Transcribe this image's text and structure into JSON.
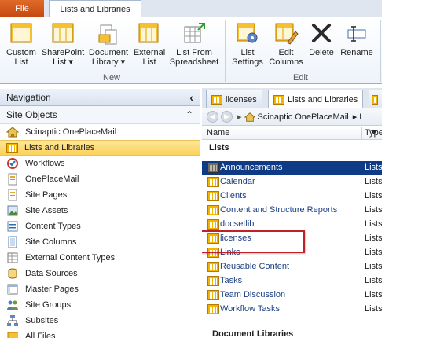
{
  "ribbon_tabs": {
    "file": "File",
    "active": "Lists and Libraries"
  },
  "ribbon": {
    "new_group": "New",
    "edit_group": "Edit",
    "buttons": [
      {
        "line1": "Custom",
        "line2": "List",
        "icon": "custom-list-icon"
      },
      {
        "line1": "SharePoint",
        "line2": "List ▾",
        "icon": "sharepoint-list-icon"
      },
      {
        "line1": "Document",
        "line2": "Library ▾",
        "icon": "document-library-icon"
      },
      {
        "line1": "External",
        "line2": "List",
        "icon": "external-list-icon"
      },
      {
        "line1": "List From",
        "line2": "Spreadsheet",
        "icon": "list-from-spreadsheet-icon"
      },
      {
        "line1": "List",
        "line2": "Settings",
        "icon": "list-settings-icon"
      },
      {
        "line1": "Edit",
        "line2": "Columns",
        "icon": "edit-columns-icon"
      },
      {
        "line1": "Delete",
        "line2": "",
        "icon": "delete-icon"
      },
      {
        "line1": "Rename",
        "line2": "",
        "icon": "rename-icon"
      }
    ]
  },
  "nav": {
    "title": "Navigation",
    "collapse_glyph": "‹",
    "site_objects": "Site Objects",
    "site_objects_glyph": "⌃",
    "items": [
      {
        "label": "Scinaptic OnePlaceMail",
        "icon": "home-icon"
      },
      {
        "label": "Lists and Libraries",
        "icon": "list-icon"
      },
      {
        "label": "Workflows",
        "icon": "workflow-icon"
      },
      {
        "label": "OnePlaceMail",
        "icon": "page-icon"
      },
      {
        "label": "Site Pages",
        "icon": "page-icon"
      },
      {
        "label": "Site Assets",
        "icon": "image-icon"
      },
      {
        "label": "Content Types",
        "icon": "content-types-icon"
      },
      {
        "label": "Site Columns",
        "icon": "columns-icon"
      },
      {
        "label": "External Content Types",
        "icon": "external-content-icon"
      },
      {
        "label": "Data Sources",
        "icon": "database-icon"
      },
      {
        "label": "Master Pages",
        "icon": "master-page-icon"
      },
      {
        "label": "Site Groups",
        "icon": "groups-icon"
      },
      {
        "label": "Subsites",
        "icon": "subsites-icon"
      },
      {
        "label": "All Files",
        "icon": "files-icon"
      }
    ]
  },
  "doc_tabs": [
    {
      "label": "licenses"
    },
    {
      "label": "Lists and Libraries"
    }
  ],
  "breadcrumb": {
    "back": "◀",
    "forward": "▶",
    "separator": "▸",
    "site": "Scinaptic OnePlaceMail",
    "next": "▸ L"
  },
  "list_view": {
    "col_name": "Name",
    "col_type": "Type",
    "section_lists": "Lists",
    "section_docs": "Document Libraries",
    "rows": [
      {
        "name": "Announcements",
        "type": "Lists"
      },
      {
        "name": "Calendar",
        "type": "Lists"
      },
      {
        "name": "Clients",
        "type": "Lists"
      },
      {
        "name": "Content and Structure Reports",
        "type": "Lists"
      },
      {
        "name": "docsetlib",
        "type": "Lists"
      },
      {
        "name": "licenses",
        "type": "Lists"
      },
      {
        "name": "Links",
        "type": "Lists"
      },
      {
        "name": "Reusable Content",
        "type": "Lists"
      },
      {
        "name": "Tasks",
        "type": "Lists"
      },
      {
        "name": "Team Discussion",
        "type": "Lists"
      },
      {
        "name": "Workflow Tasks",
        "type": "Lists"
      }
    ]
  },
  "colors": {
    "file_tab": "#d2561c",
    "selected_nav": "#fbd15a",
    "selected_row": "#0f3a86",
    "callout": "#c0202a"
  }
}
